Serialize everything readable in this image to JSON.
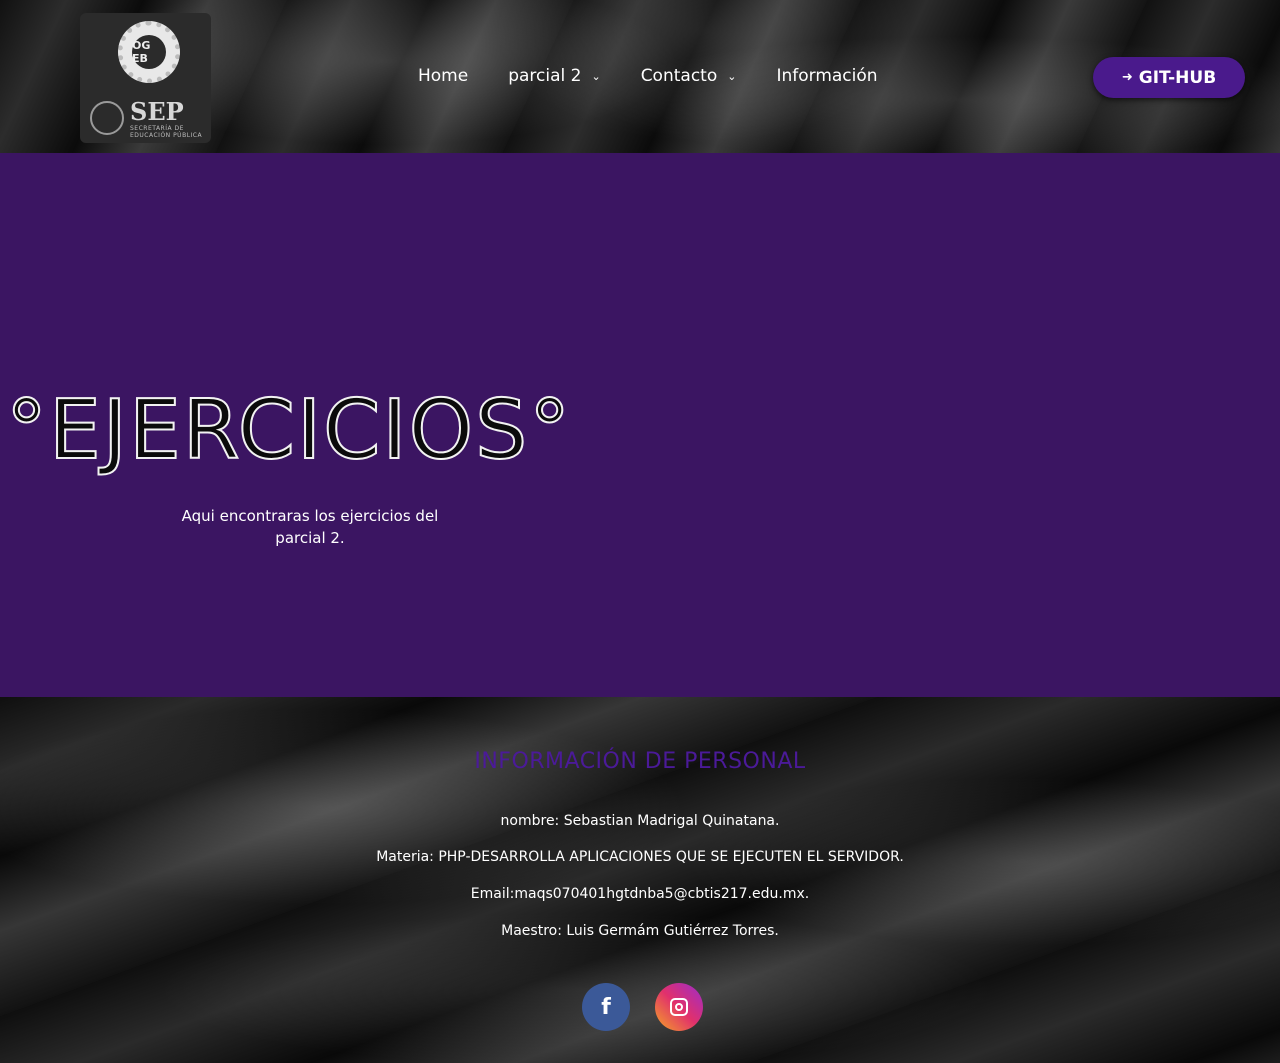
{
  "header": {
    "logo": {
      "badge_text": "OG EB",
      "brand": "SEP",
      "brand_sub": "SECRETARÍA DE EDUCACIÓN PÚBLICA"
    },
    "nav": [
      {
        "label": "Home",
        "has_dropdown": false
      },
      {
        "label": "parcial 2",
        "has_dropdown": true
      },
      {
        "label": "Contacto",
        "has_dropdown": true
      },
      {
        "label": "Información",
        "has_dropdown": false
      }
    ],
    "cta": {
      "label": "GIT-HUB",
      "icon": "login-icon"
    }
  },
  "hero": {
    "title": "°EJERCICIOS°",
    "subtitle": "Aqui encontraras los ejercicios del parcial 2.",
    "background": "#3b1562"
  },
  "footer": {
    "title": "INFORMACIÓN DE PERSONAL",
    "lines": [
      "nombre: Sebastian Madrigal Quinatana.",
      "Materia: PHP-DESARROLLA APLICACIONES QUE SE EJECUTEN EL SERVIDOR.",
      "Email:maqs070401hgtdnba5@cbtis217.edu.mx.",
      "Maestro: Luis Germám Gutiérrez Torres."
    ],
    "social": [
      {
        "name": "facebook",
        "icon": "facebook-icon",
        "color": "#3b5998"
      },
      {
        "name": "instagram",
        "icon": "instagram-icon",
        "color": "#e1306c"
      }
    ]
  },
  "colors": {
    "accent": "#4a1a8c",
    "title": "#4b1a99"
  }
}
